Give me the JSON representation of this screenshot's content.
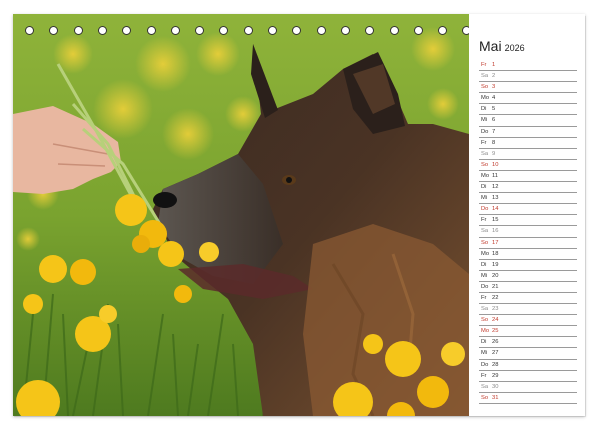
{
  "calendar": {
    "month": "Mai",
    "year": "2026",
    "days": [
      {
        "wd": "Fr",
        "num": "1",
        "kind": "holiday"
      },
      {
        "wd": "Sa",
        "num": "2",
        "kind": "saturday"
      },
      {
        "wd": "So",
        "num": "3",
        "kind": "sunday"
      },
      {
        "wd": "Mo",
        "num": "4",
        "kind": "weekday"
      },
      {
        "wd": "Di",
        "num": "5",
        "kind": "weekday"
      },
      {
        "wd": "Mi",
        "num": "6",
        "kind": "weekday"
      },
      {
        "wd": "Do",
        "num": "7",
        "kind": "weekday"
      },
      {
        "wd": "Fr",
        "num": "8",
        "kind": "weekday"
      },
      {
        "wd": "Sa",
        "num": "9",
        "kind": "saturday"
      },
      {
        "wd": "So",
        "num": "10",
        "kind": "sunday"
      },
      {
        "wd": "Mo",
        "num": "11",
        "kind": "weekday"
      },
      {
        "wd": "Di",
        "num": "12",
        "kind": "weekday"
      },
      {
        "wd": "Mi",
        "num": "13",
        "kind": "weekday"
      },
      {
        "wd": "Do",
        "num": "14",
        "kind": "holiday"
      },
      {
        "wd": "Fr",
        "num": "15",
        "kind": "weekday"
      },
      {
        "wd": "Sa",
        "num": "16",
        "kind": "saturday"
      },
      {
        "wd": "So",
        "num": "17",
        "kind": "sunday"
      },
      {
        "wd": "Mo",
        "num": "18",
        "kind": "weekday"
      },
      {
        "wd": "Di",
        "num": "19",
        "kind": "weekday"
      },
      {
        "wd": "Mi",
        "num": "20",
        "kind": "weekday"
      },
      {
        "wd": "Do",
        "num": "21",
        "kind": "weekday"
      },
      {
        "wd": "Fr",
        "num": "22",
        "kind": "weekday"
      },
      {
        "wd": "Sa",
        "num": "23",
        "kind": "saturday"
      },
      {
        "wd": "So",
        "num": "24",
        "kind": "sunday"
      },
      {
        "wd": "Mo",
        "num": "25",
        "kind": "holiday"
      },
      {
        "wd": "Di",
        "num": "26",
        "kind": "weekday"
      },
      {
        "wd": "Mi",
        "num": "27",
        "kind": "weekday"
      },
      {
        "wd": "Do",
        "num": "28",
        "kind": "weekday"
      },
      {
        "wd": "Fr",
        "num": "29",
        "kind": "weekday"
      },
      {
        "wd": "Sa",
        "num": "30",
        "kind": "saturday"
      },
      {
        "wd": "So",
        "num": "31",
        "kind": "sunday"
      }
    ]
  },
  "photo": {
    "subject": "dog-with-dandelions",
    "colors": {
      "meadow": "#6f9a2e",
      "flower": "#f5c518",
      "fur_dark": "#2a1f1a",
      "fur_brown": "#8a5a33"
    }
  },
  "colors": {
    "weekday": "#333333",
    "saturday": "#8a8a8a",
    "sunday": "#c0392b",
    "rule": "#9a9a9a"
  }
}
